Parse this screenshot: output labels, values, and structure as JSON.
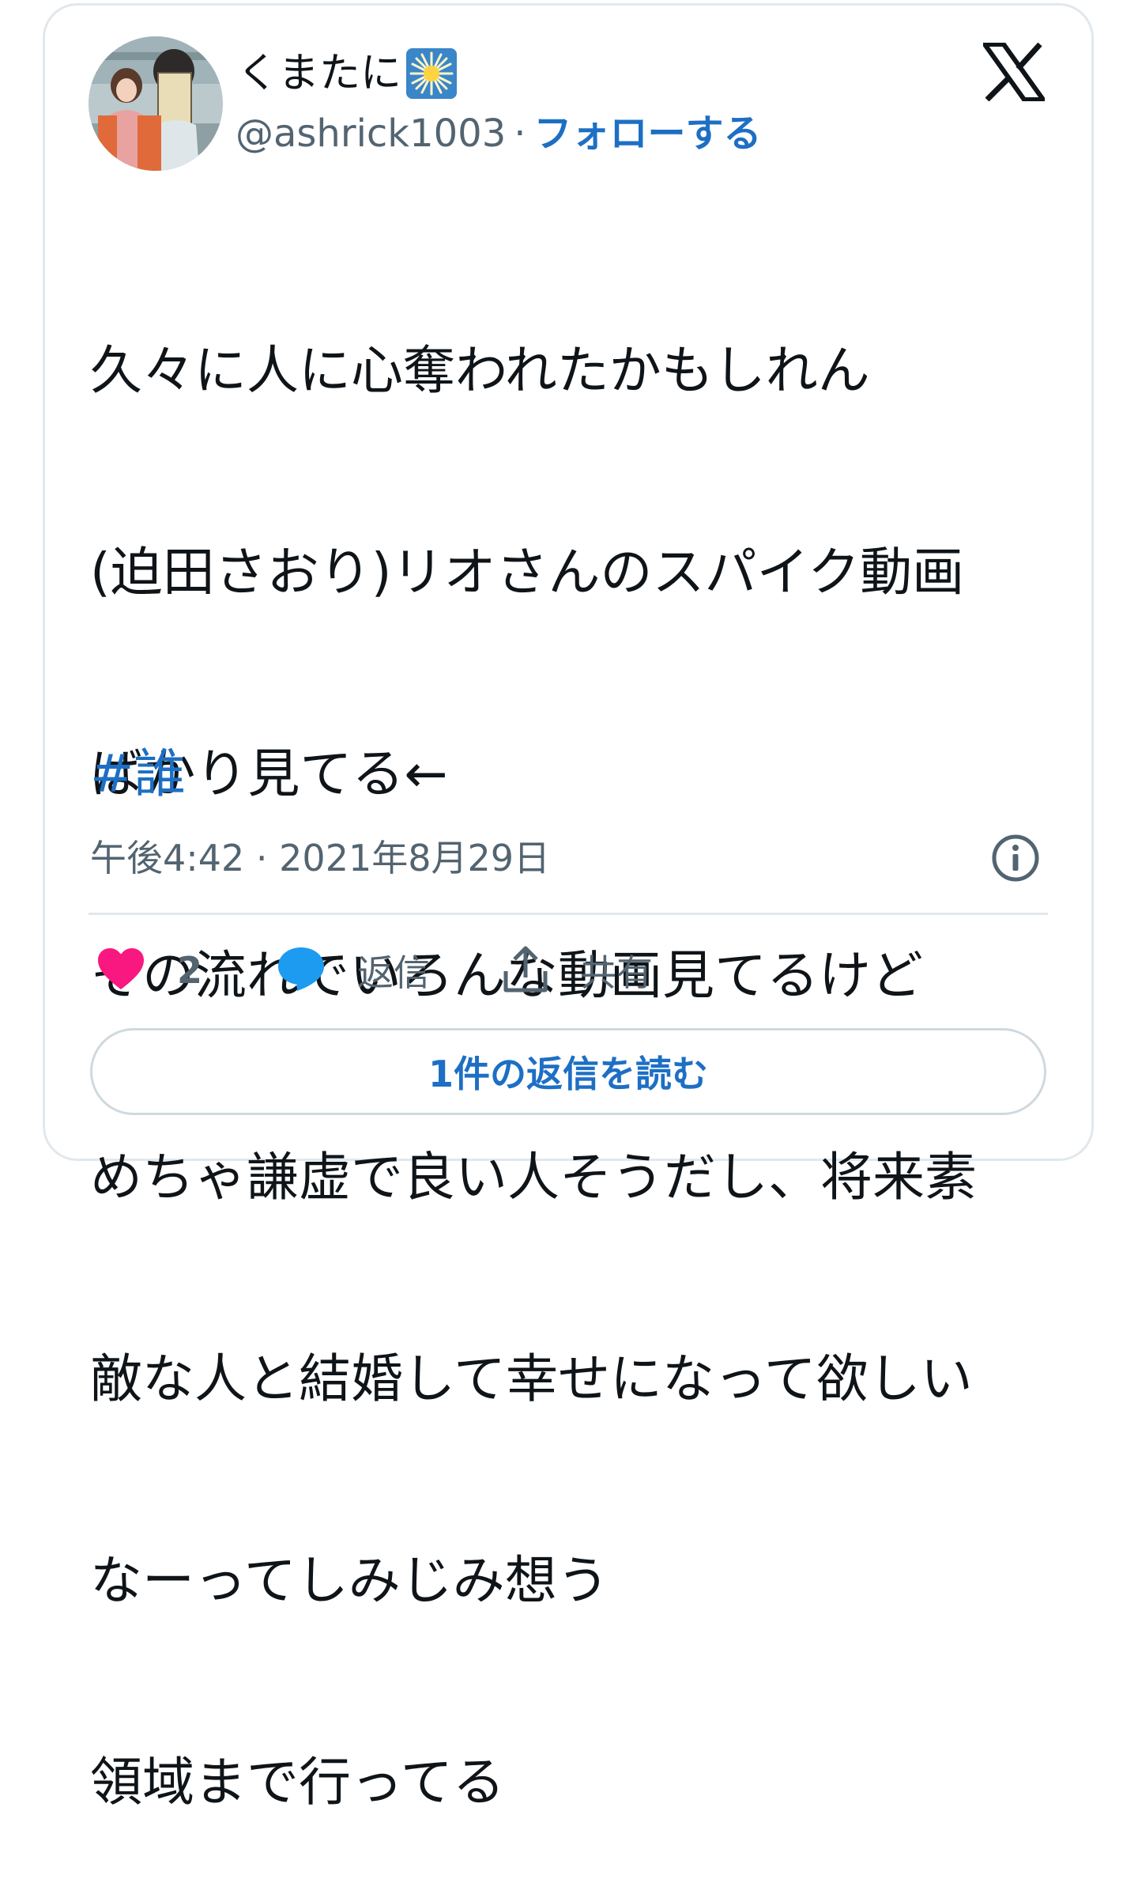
{
  "author": {
    "display_name": "くまたに",
    "badge_icon": "sparkle-emoji-icon",
    "handle": "@ashrick1003",
    "separator": "·",
    "follow_label": "フォローする"
  },
  "platform_icon": "x-logo-icon",
  "tweet": {
    "text_lines": [
      "久々に人に心奪われたかもしれん",
      "(迫田さおり)リオさんのスパイク動画",
      "ばかり見てる←",
      "その流れでいろんな動画見てるけど",
      "めちゃ謙虚で良い人そうだし、将来素",
      "敵な人と結婚して幸せになって欲しい",
      "なーってしみじみ想う",
      "領域まで行ってる"
    ],
    "hashtag": "#誰",
    "timestamp": "午後4:42 · 2021年8月29日"
  },
  "actions": {
    "like_count": "2",
    "reply_label": "返信",
    "share_label": "共有"
  },
  "read_replies_label": "1件の返信を読む",
  "colors": {
    "link": "#1d6fc4",
    "heart": "#f91880",
    "reply_bubble": "#1d9bf0",
    "secondary_text": "#536471",
    "border": "#e1e8ed"
  }
}
